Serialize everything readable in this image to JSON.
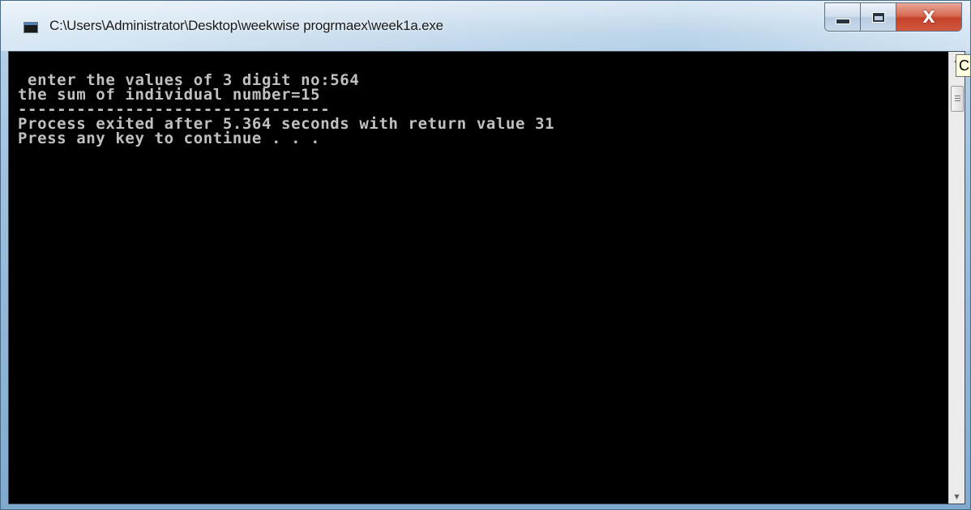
{
  "window": {
    "title": "C:\\Users\\Administrator\\Desktop\\weekwise progrmaex\\week1a.exe",
    "icon": "console-app-icon",
    "controls": {
      "minimize": "minimize-icon",
      "maximize": "maximize-icon",
      "close": "close-icon",
      "close_glyph": "X"
    }
  },
  "console": {
    "lines": [
      " enter the values of 3 digit no:564",
      "the sum of individual number=15",
      "--------------------------------",
      "Process exited after 5.364 seconds with return value 31",
      "Press any key to continue . . ."
    ],
    "background": "#000000",
    "foreground": "#c0c0c0"
  },
  "tooltip": {
    "partial_text": "C"
  }
}
